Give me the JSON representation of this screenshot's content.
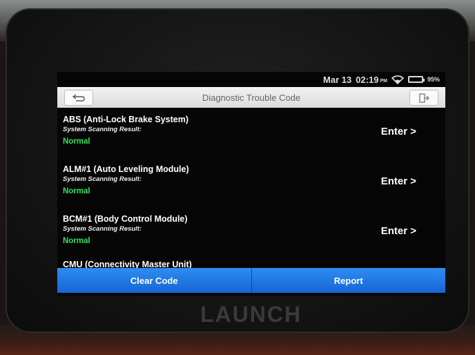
{
  "status_bar": {
    "date": "Mar 13",
    "time": "02:19",
    "ampm": "PM",
    "battery": "95%"
  },
  "header": {
    "title": "Diagnostic Trouble Code"
  },
  "systems": [
    {
      "name": "ABS (Anti-Lock Brake System)",
      "subtitle": "System Scanning Result:",
      "status": "Normal",
      "action": "Enter >"
    },
    {
      "name": "ALM#1 (Auto Leveling Module)",
      "subtitle": "System Scanning Result:",
      "status": "Normal",
      "action": "Enter >"
    },
    {
      "name": "BCM#1 (Body Control Module)",
      "subtitle": "System Scanning Result:",
      "status": "Normal",
      "action": "Enter >"
    }
  ],
  "partial_row": "CMU (Connectivity Master Unit)",
  "actions": {
    "clear_code": "Clear Code",
    "report": "Report"
  },
  "device": {
    "brand": "LAUNCH"
  },
  "colors": {
    "status_normal": "#31e05a",
    "button_blue": "#1e78e6",
    "title_bar": "#e8e8e8"
  }
}
